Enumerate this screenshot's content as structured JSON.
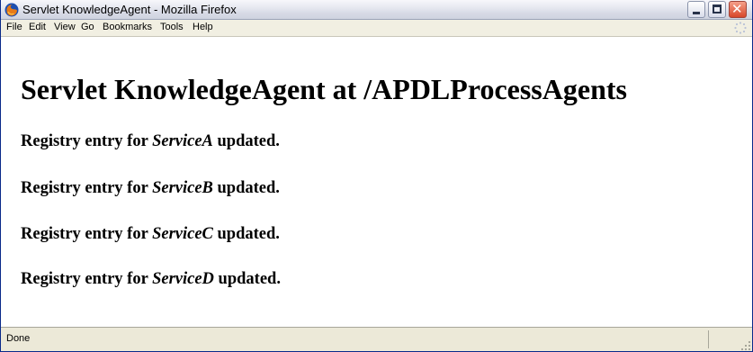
{
  "window": {
    "title": "Servlet KnowledgeAgent - Mozilla Firefox",
    "app_icon": "firefox-icon",
    "controls": {
      "minimize": "minimize-icon",
      "maximize": "maximize-icon",
      "close": "close-icon"
    }
  },
  "menu": {
    "items": [
      "File",
      "Edit",
      "View",
      "Go",
      "Bookmarks",
      "Tools",
      "Help"
    ],
    "throbber_icon": "throbber-icon"
  },
  "page": {
    "heading": "Servlet KnowledgeAgent at /APDLProcessAgents",
    "entries": [
      {
        "prefix": "Registry entry for ",
        "service": "ServiceA",
        "suffix": " updated."
      },
      {
        "prefix": "Registry entry for ",
        "service": "ServiceB",
        "suffix": " updated."
      },
      {
        "prefix": "Registry entry for ",
        "service": "ServiceC",
        "suffix": " updated."
      },
      {
        "prefix": "Registry entry for ",
        "service": "ServiceD",
        "suffix": " updated."
      }
    ]
  },
  "status": {
    "text": "Done",
    "grip_icon": "resize-grip-icon"
  },
  "colors": {
    "text": "#000000",
    "content_bg": "#ffffff",
    "chrome_bg": "#ece9d8",
    "close_button": "#d8472a"
  }
}
